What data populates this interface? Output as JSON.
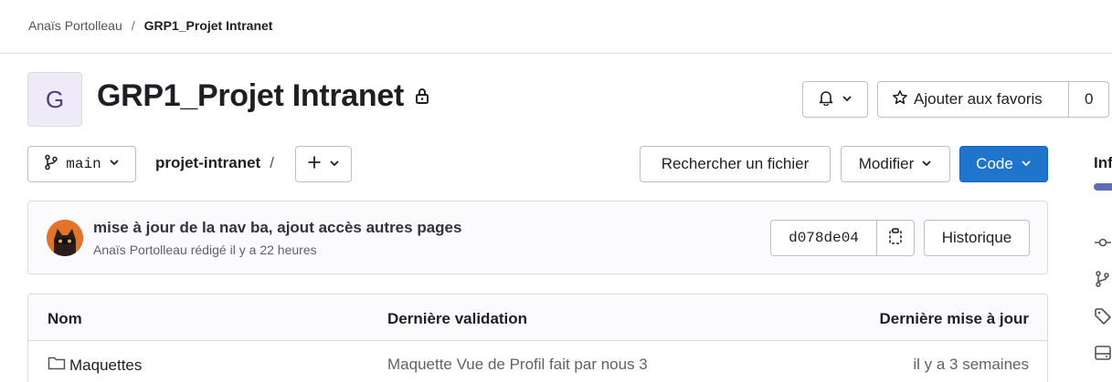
{
  "breadcrumb": {
    "user": "Anaïs Portolleau",
    "separator": "/",
    "project": "GRP1_Projet Intranet"
  },
  "project": {
    "avatar_letter": "G",
    "title": "GRP1_Projet Intranet"
  },
  "header_actions": {
    "notifications_icon": "bell-icon",
    "star_label": "Ajouter aux favoris",
    "star_count": "0"
  },
  "repo_toolbar": {
    "branch": "main",
    "path_root": "projet-intranet",
    "path_separator": "/",
    "search_label": "Rechercher un fichier",
    "edit_label": "Modifier",
    "code_label": "Code"
  },
  "last_commit": {
    "title": "mise à jour de la nav ba, ajout accès autres pages",
    "author": "Anaïs Portolleau",
    "action": "rédigé",
    "time": "il y a 22 heures",
    "sha": "d078de04",
    "history_label": "Historique"
  },
  "files_table": {
    "headers": {
      "name": "Nom",
      "last_commit": "Dernière validation",
      "last_update": "Dernière mise à jour"
    },
    "rows": [
      {
        "name": "Maquettes",
        "commit": "Maquette Vue de Profil fait par nous 3",
        "updated": "il y a 3 semaines"
      }
    ]
  },
  "sidebar": {
    "label_fragment": "Inf"
  },
  "colors": {
    "primary_button": "#1f75cb",
    "progress_bar": "#5d6cb5"
  }
}
